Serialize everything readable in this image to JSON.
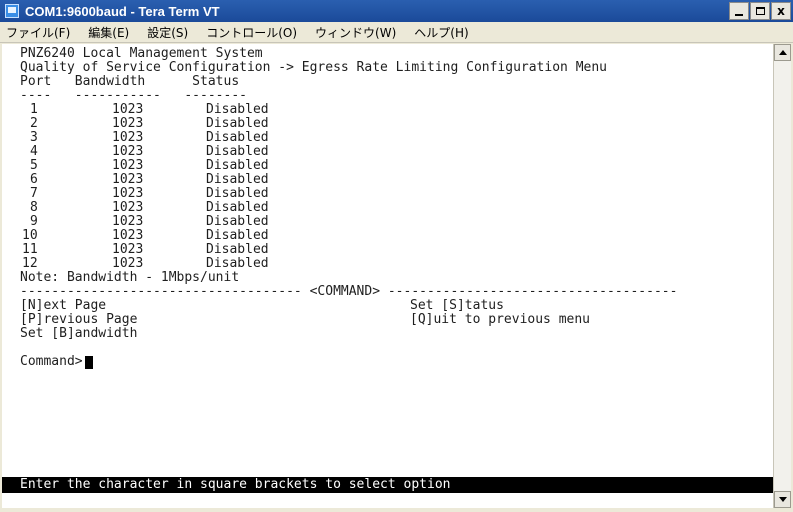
{
  "window": {
    "title": "COM1:9600baud - Tera Term VT",
    "controls": {
      "minimize": "_",
      "maximize": "□",
      "close": "x"
    }
  },
  "menu": {
    "items": [
      "ファイル(F)",
      "編集(E)",
      "設定(S)",
      "コントロール(O)",
      "ウィンドウ(W)",
      "ヘルプ(H)"
    ]
  },
  "terminal": {
    "system_title": "PNZ6240 Local Management System",
    "menu_path": "Quality of Service Configuration -> Egress Rate Limiting Configuration Menu",
    "table": {
      "header": "Port   Bandwidth      Status",
      "divider": "----   -----------   --------",
      "rows": [
        {
          "port": "1",
          "bandwidth": "1023",
          "status": "Disabled"
        },
        {
          "port": "2",
          "bandwidth": "1023",
          "status": "Disabled"
        },
        {
          "port": "3",
          "bandwidth": "1023",
          "status": "Disabled"
        },
        {
          "port": "4",
          "bandwidth": "1023",
          "status": "Disabled"
        },
        {
          "port": "5",
          "bandwidth": "1023",
          "status": "Disabled"
        },
        {
          "port": "6",
          "bandwidth": "1023",
          "status": "Disabled"
        },
        {
          "port": "7",
          "bandwidth": "1023",
          "status": "Disabled"
        },
        {
          "port": "8",
          "bandwidth": "1023",
          "status": "Disabled"
        },
        {
          "port": "9",
          "bandwidth": "1023",
          "status": "Disabled"
        },
        {
          "port": "10",
          "bandwidth": "1023",
          "status": "Disabled"
        },
        {
          "port": "11",
          "bandwidth": "1023",
          "status": "Disabled"
        },
        {
          "port": "12",
          "bandwidth": "1023",
          "status": "Disabled"
        }
      ]
    },
    "note": "Note: Bandwidth - 1Mbps/unit",
    "command_divider": "------------------------------------ <COMMAND> -------------------------------------",
    "commands": {
      "next_page": "[N]ext Page",
      "previous_page": "[P]revious Page",
      "set_bandwidth": "Set [B]andwidth",
      "set_status": "Set [S]tatus",
      "quit": "[Q]uit to previous menu"
    },
    "prompt": "Command>",
    "status_message": "Enter the character in square brackets to select option"
  },
  "colors": {
    "titlebar": "#1b4a99",
    "terminal_bg": "#ffffff",
    "terminal_fg": "#1e1e1e",
    "status_bar_bg": "#000000",
    "status_bar_fg": "#ffffff"
  }
}
